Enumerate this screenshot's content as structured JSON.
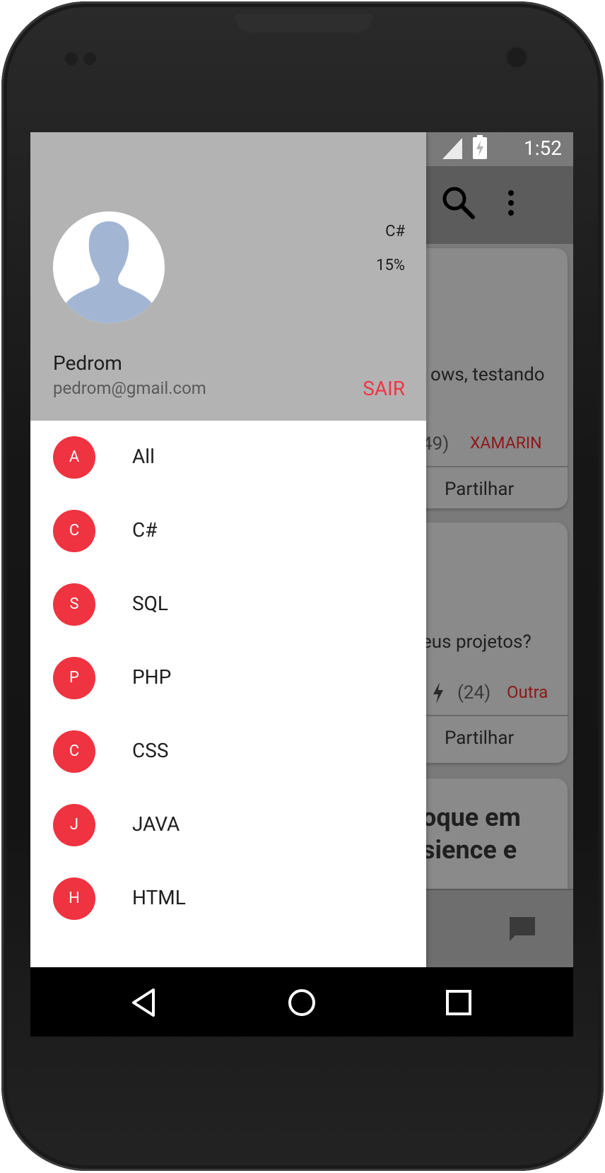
{
  "status_bar": {
    "time": "1:52"
  },
  "drawer": {
    "header": {
      "user_name": "Pedrom",
      "user_email": "pedrom@gmail.com",
      "language": "C#",
      "progress_text": "15%",
      "logout_label": "SAIR"
    },
    "items": [
      {
        "initial": "A",
        "label": "All"
      },
      {
        "initial": "C",
        "label": "C#"
      },
      {
        "initial": "S",
        "label": "SQL"
      },
      {
        "initial": "P",
        "label": "PHP"
      },
      {
        "initial": "C",
        "label": "CSS"
      },
      {
        "initial": "J",
        "label": "JAVA"
      },
      {
        "initial": "H",
        "label": "HTML"
      }
    ]
  },
  "background": {
    "card1": {
      "text": "ows, testando",
      "count": "49)",
      "tag": "XAMARIN",
      "share": "Partilhar"
    },
    "card2": {
      "text": "eus projetos?",
      "count": "(24)",
      "tag": "Outra",
      "share": "Partilhar"
    },
    "card3": {
      "title_line1": "oque em",
      "title_line2": "sience e"
    },
    "fab_symbol": "+"
  },
  "colors": {
    "accent": "#ef3340",
    "header_bg": "#b3b3b3",
    "logout": "#ef3544"
  }
}
